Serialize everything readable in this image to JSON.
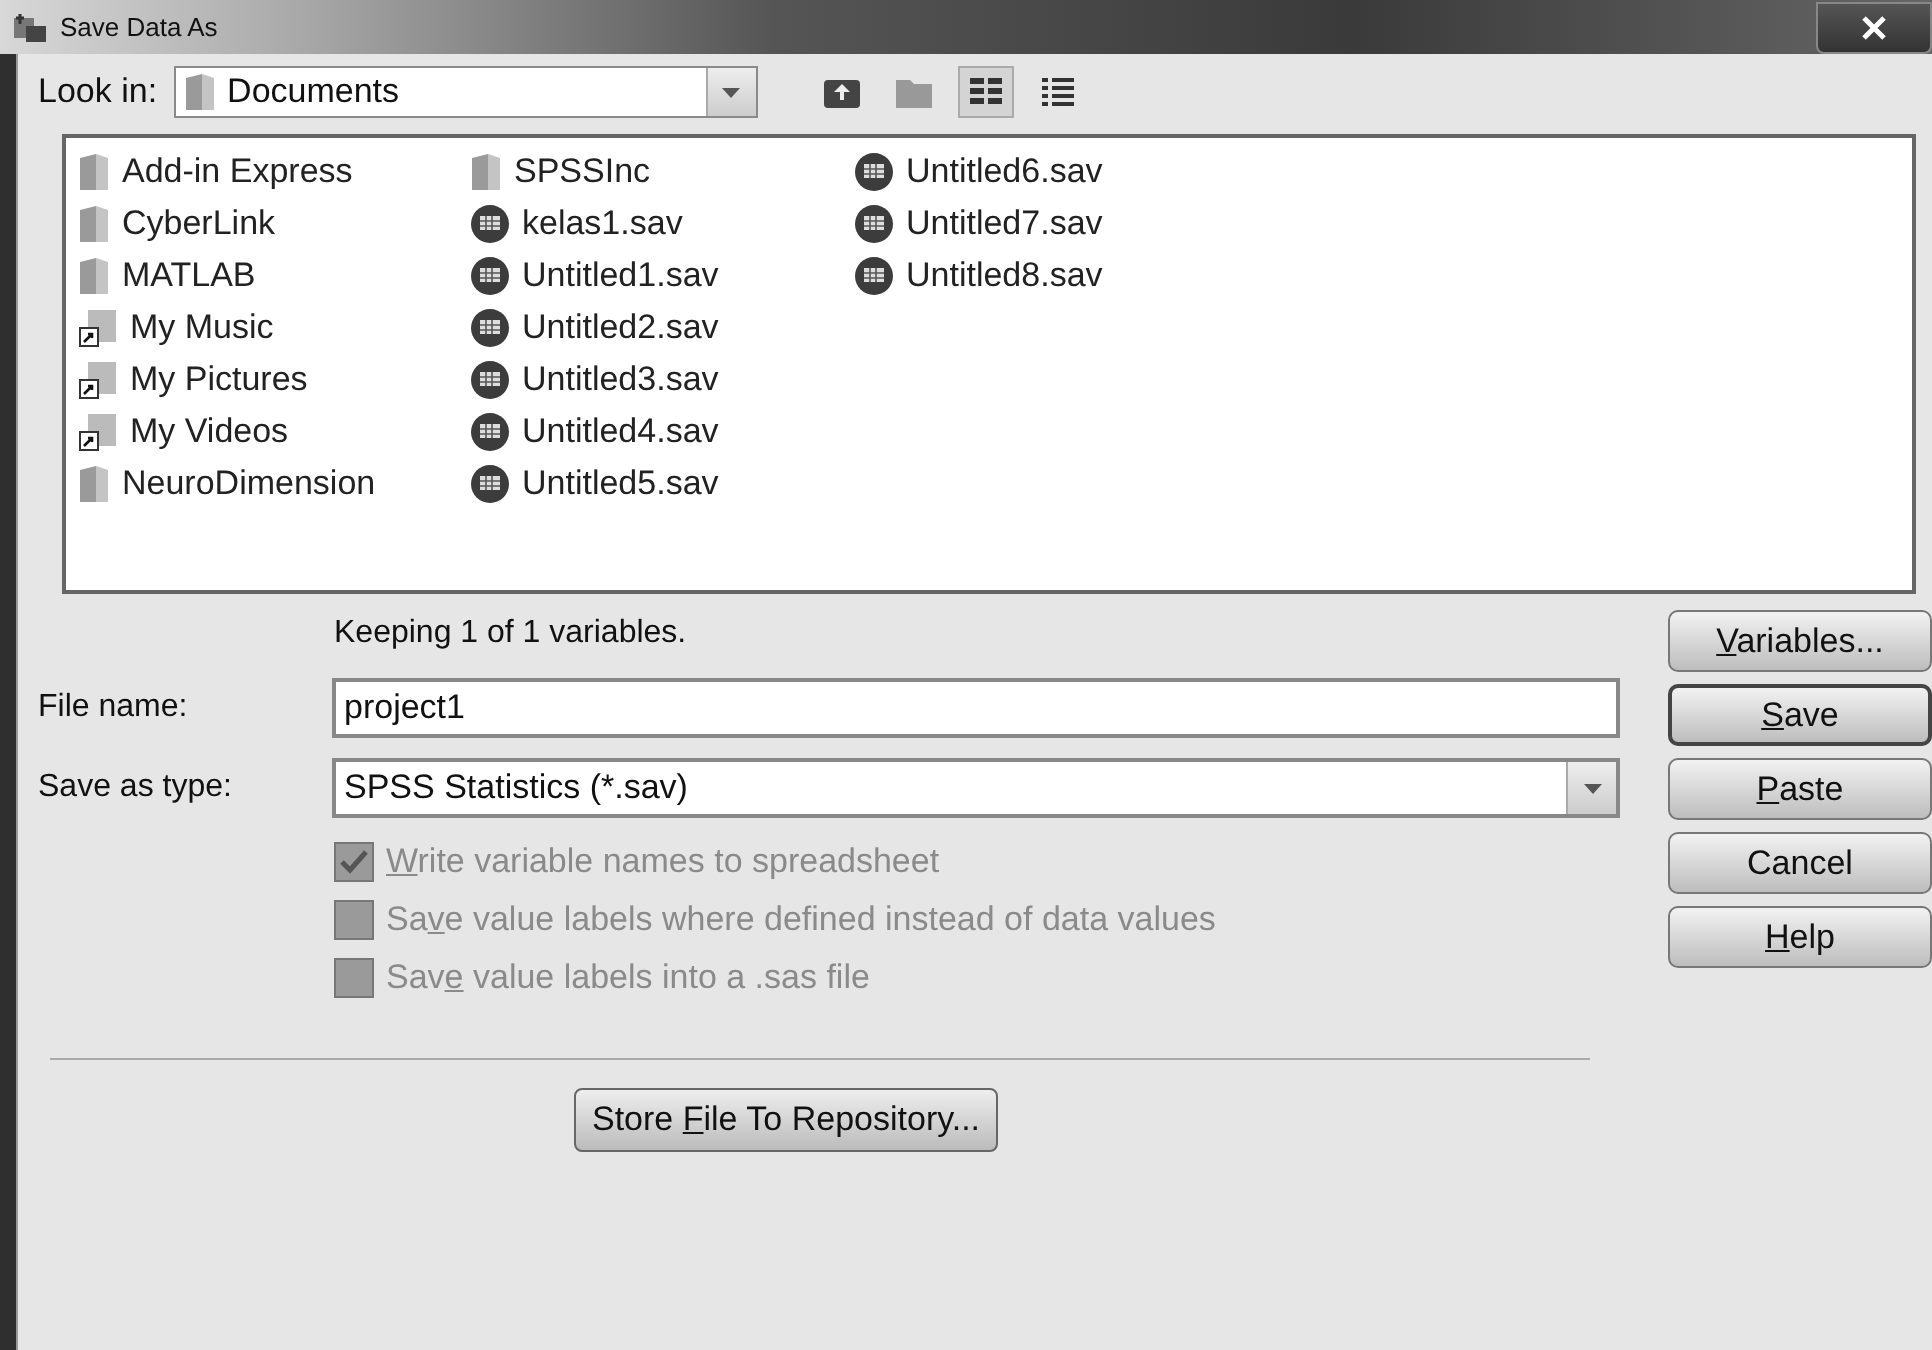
{
  "window": {
    "title": "Save Data As"
  },
  "look_in": {
    "label": "Look in:",
    "value": "Documents"
  },
  "toolbar": [
    {
      "kind": "up",
      "selected": false
    },
    {
      "kind": "new-folder",
      "selected": false
    },
    {
      "kind": "list",
      "selected": true
    },
    {
      "kind": "details",
      "selected": false
    }
  ],
  "files": [
    {
      "name": "Add-in Express",
      "kind": "folder"
    },
    {
      "name": "CyberLink",
      "kind": "folder"
    },
    {
      "name": "MATLAB",
      "kind": "folder"
    },
    {
      "name": "My Music",
      "kind": "shortcut"
    },
    {
      "name": "My Pictures",
      "kind": "shortcut"
    },
    {
      "name": "My Videos",
      "kind": "shortcut"
    },
    {
      "name": "NeuroDimension",
      "kind": "folder"
    },
    {
      "name": "SPSSInc",
      "kind": "folder"
    },
    {
      "name": "kelas1.sav",
      "kind": "sav"
    },
    {
      "name": "Untitled1.sav",
      "kind": "sav"
    },
    {
      "name": "Untitled2.sav",
      "kind": "sav"
    },
    {
      "name": "Untitled3.sav",
      "kind": "sav"
    },
    {
      "name": "Untitled4.sav",
      "kind": "sav"
    },
    {
      "name": "Untitled5.sav",
      "kind": "sav"
    },
    {
      "name": "Untitled6.sav",
      "kind": "sav"
    },
    {
      "name": "Untitled7.sav",
      "kind": "sav"
    },
    {
      "name": "Untitled8.sav",
      "kind": "sav"
    }
  ],
  "info": "Keeping 1 of 1 variables.",
  "file_name": {
    "label": "File name:",
    "value": "project1"
  },
  "save_as_type": {
    "label": "Save as type:",
    "value": "SPSS Statistics (*.sav)"
  },
  "options": [
    {
      "label": {
        "key": "W",
        "post": "rite variable names to spreadsheet"
      },
      "checked": true,
      "disabled": true
    },
    {
      "label": {
        "pre": "Sa",
        "key": "v",
        "post": "e value labels where defined instead of data values"
      },
      "checked": false,
      "disabled": true
    },
    {
      "label": {
        "pre": "Sav",
        "key": "e",
        "post": " value labels into a .sas file"
      },
      "checked": false,
      "disabled": true
    }
  ],
  "repository_button": {
    "pre": "Store ",
    "key": "F",
    "post": "ile To Repository..."
  },
  "buttons": [
    {
      "label": {
        "key": "V",
        "post": "ariables..."
      },
      "default": false
    },
    {
      "label": {
        "key": "S",
        "post": "ave"
      },
      "default": true
    },
    {
      "label": {
        "key": "P",
        "post": "aste"
      },
      "default": false
    },
    {
      "label": {
        "pre": "Cancel"
      },
      "default": false
    },
    {
      "label": {
        "key": "H",
        "post": "elp"
      },
      "default": false
    }
  ]
}
